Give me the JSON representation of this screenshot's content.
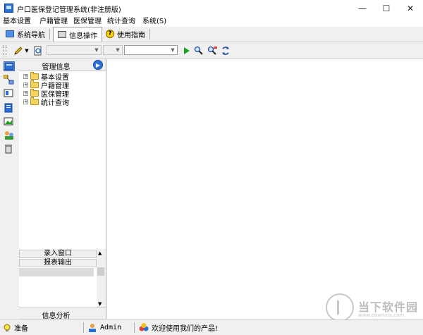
{
  "window": {
    "title": "户口医保登记管理系统(非注册版)",
    "minimize": "—",
    "maximize": "☐",
    "close": "✕"
  },
  "menu": [
    "基本设置",
    "户籍管理",
    "医保管理",
    "统计查询",
    "系统(S)"
  ],
  "tabs": [
    {
      "label": "系统导航",
      "icon": "navigation-icon"
    },
    {
      "label": "信息操作",
      "icon": "form-icon"
    },
    {
      "label": "使用指南",
      "icon": "help-icon"
    }
  ],
  "toolbar": {
    "combo1": "",
    "combo2": "",
    "combo3": ""
  },
  "panel": {
    "title": "管理信息",
    "tree": [
      "基本设置",
      "户籍管理",
      "医保管理",
      "统计查询"
    ],
    "buttons": [
      "录入窗口",
      "报表输出"
    ],
    "bottom": "信息分析"
  },
  "status": {
    "ready": "准备",
    "user": "Admin",
    "welcome": "欢迎使用我们的产品!"
  },
  "watermark": {
    "text": "当下软件园",
    "sub": "www.downxia.com"
  },
  "colors": {
    "accent": "#2b6fd8",
    "chrome": "#f0f0f0",
    "folder": "#f4d35e",
    "play": "#1aa31a"
  }
}
